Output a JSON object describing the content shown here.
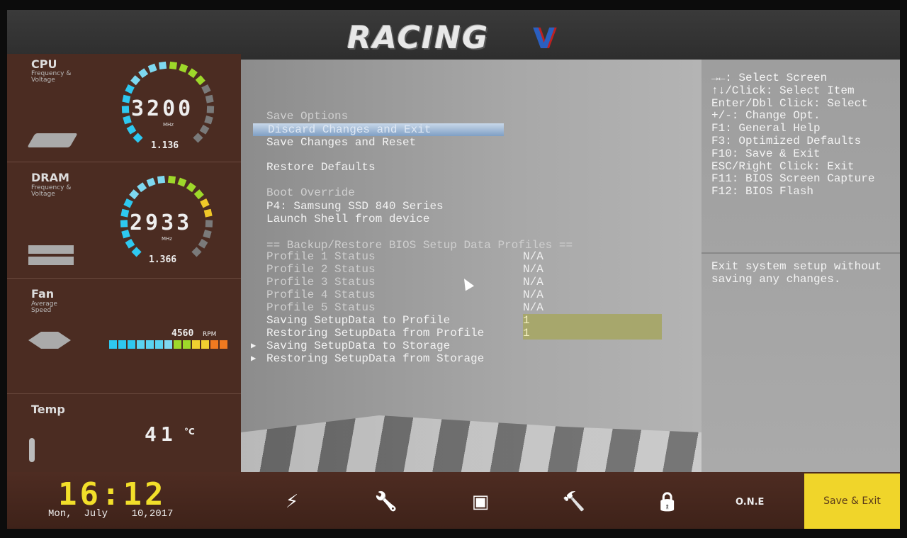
{
  "brand": {
    "logo": "RACING",
    "logo_mark": "V"
  },
  "monitor": {
    "cpu": {
      "title": "CPU",
      "subtitle": "Frequency & Voltage",
      "value": "3200",
      "unit": "MHz",
      "voltage": "1.136",
      "segments": [
        "#2ec8f0",
        "#2ec8f0",
        "#2ec8f0",
        "#2ec8f0",
        "#2ec8f0",
        "#2ec8f0",
        "#7ed8f0",
        "#7ed8f0",
        "#7ed8f0",
        "#7ed8f0",
        "#9ed82a",
        "#9ed82a",
        "#9ed82a",
        "#9ed82a",
        "#7a7a7a",
        "#7a7a7a",
        "#7a7a7a",
        "#7a7a7a",
        "#7a7a7a",
        "#7a7a7a"
      ]
    },
    "dram": {
      "title": "DRAM",
      "subtitle": "Frequency & Voltage",
      "value": "2933",
      "unit": "MHz",
      "voltage": "1.366",
      "segments": [
        "#2ec8f0",
        "#2ec8f0",
        "#2ec8f0",
        "#2ec8f0",
        "#2ec8f0",
        "#2ec8f0",
        "#7ed8f0",
        "#7ed8f0",
        "#7ed8f0",
        "#7ed8f0",
        "#9ed82a",
        "#9ed82a",
        "#9ed82a",
        "#9ed82a",
        "#f0c828",
        "#f0c828",
        "#7a7a7a",
        "#7a7a7a",
        "#7a7a7a",
        "#7a7a7a"
      ]
    },
    "fan": {
      "title": "Fan",
      "subtitle": "Average Speed",
      "value": "4560",
      "unit": "RPM",
      "bar": [
        "#2ec8f0",
        "#2ec8f0",
        "#2ec8f0",
        "#5ad4f0",
        "#5ad4f0",
        "#5ad4f0",
        "#7ed8f0",
        "#9ed82a",
        "#9ed82a",
        "#f0d030",
        "#f0d030",
        "#f07a20",
        "#f07a20"
      ]
    },
    "temp": {
      "title": "Temp",
      "value": "41",
      "unit": "°C"
    }
  },
  "menu": {
    "items": [
      {
        "label": "Save Options",
        "type": "header"
      },
      {
        "label": "Discard Changes and Exit",
        "type": "selected"
      },
      {
        "label": "Save Changes and Reset",
        "type": "item"
      },
      {
        "label": "Restore Defaults",
        "type": "item"
      },
      {
        "label": "Boot Override",
        "type": "header"
      },
      {
        "label": "P4: Samsung SSD 840 Series",
        "type": "item"
      },
      {
        "label": "Launch Shell from device",
        "type": "item"
      },
      {
        "label": "== Backup/Restore BIOS Setup Data Profiles ==",
        "type": "header"
      },
      {
        "label": "Profile 1 Status",
        "type": "header",
        "value": "N/A"
      },
      {
        "label": "Profile 2 Status",
        "type": "header",
        "value": "N/A"
      },
      {
        "label": "Profile 3 Status",
        "type": "header",
        "value": "N/A"
      },
      {
        "label": "Profile 4 Status",
        "type": "header",
        "value": "N/A"
      },
      {
        "label": "Profile 5 Status",
        "type": "header",
        "value": "N/A"
      },
      {
        "label": "Saving SetupData to Profile",
        "type": "item",
        "value": "1"
      },
      {
        "label": "Restoring SetupData from Profile",
        "type": "item",
        "value": "1"
      },
      {
        "label": "Saving SetupData to Storage",
        "type": "submenu"
      },
      {
        "label": "Restoring SetupData from Storage",
        "type": "submenu"
      }
    ],
    "submenu_marker": "▶"
  },
  "help": {
    "keys": [
      "→←: Select Screen",
      "↑↓/Click: Select Item",
      "Enter/Dbl Click: Select",
      "+/-: Change Opt.",
      "F1: General Help",
      "F3: Optimized Defaults",
      "F10: Save & Exit",
      "ESC/Right Click: Exit",
      "F11: BIOS Screen Capture",
      "F12: BIOS Flash"
    ],
    "description": "Exit system setup without saving any changes."
  },
  "footer": {
    "time": "16:12",
    "date": "Mon,  July    10,2017",
    "nav": [
      {
        "icon": "oc-tweaker-icon",
        "glyph": "⚡"
      },
      {
        "icon": "wrench-icon",
        "glyph": "🔧"
      },
      {
        "icon": "chipset-icon",
        "glyph": "▣"
      },
      {
        "icon": "tool-icon",
        "glyph": "🔨"
      },
      {
        "icon": "lock-icon",
        "glyph": "🔒"
      }
    ],
    "one_label": "O.N.E",
    "save_exit": "Save & Exit"
  }
}
